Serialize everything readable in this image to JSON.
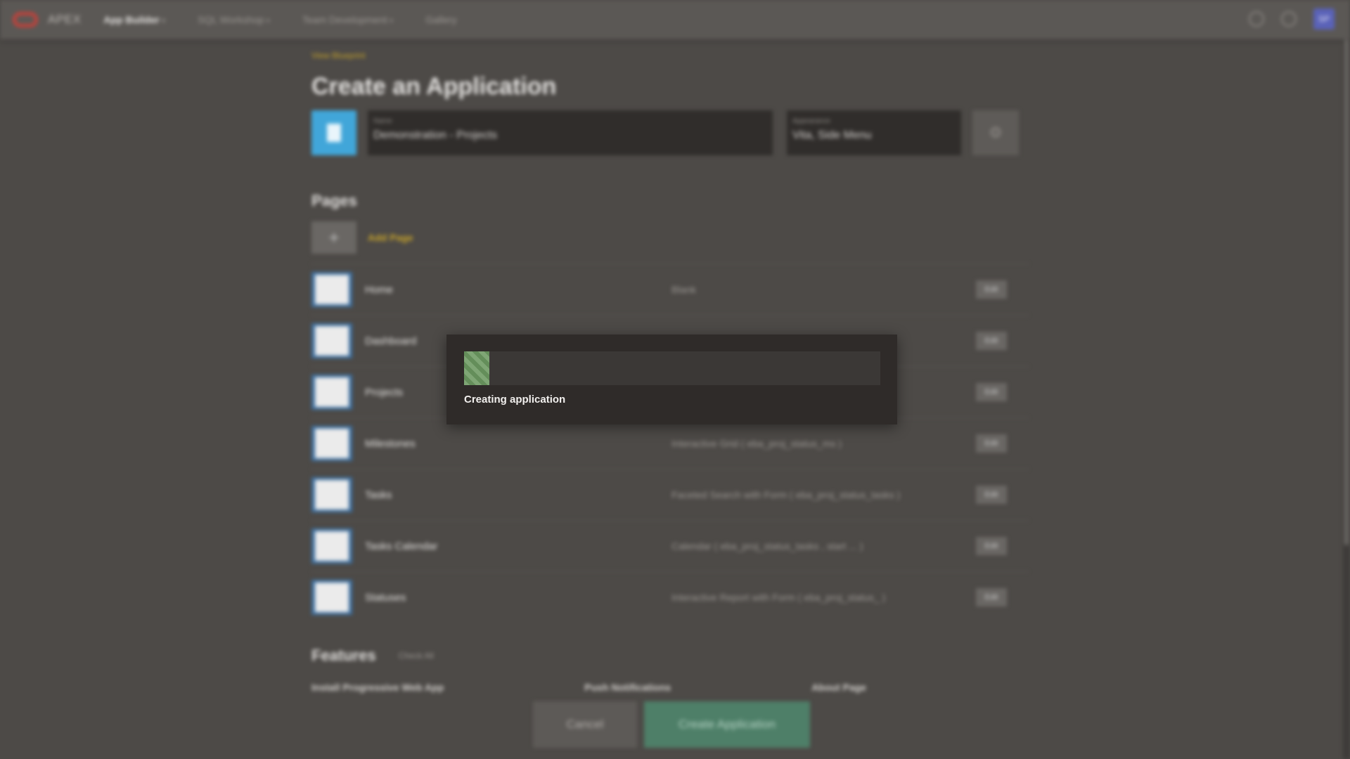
{
  "topbar": {
    "brand": "APEX",
    "nav": [
      {
        "label": "App Builder",
        "active": true,
        "caret": true
      },
      {
        "label": "SQL Workshop",
        "active": false,
        "caret": true
      },
      {
        "label": "Team Development",
        "active": false,
        "caret": true
      },
      {
        "label": "Gallery",
        "active": false,
        "caret": false
      }
    ],
    "user_initials": "SP"
  },
  "content": {
    "breadcrumb": "View Blueprint",
    "title": "Create an Application",
    "name_label": "Name",
    "name_value": "Demonstration - Projects",
    "appearance_label": "Appearance",
    "appearance_value": "Vita, Side Menu",
    "pages_title": "Pages",
    "add_page_label": "Add Page",
    "pages": [
      {
        "name": "Home",
        "type": "Blank",
        "edit": "Edit"
      },
      {
        "name": "Dashboard",
        "type": "",
        "edit": "Edit"
      },
      {
        "name": "Projects",
        "type": "",
        "edit": "Edit"
      },
      {
        "name": "Milestones",
        "type": "Interactive Grid ( eba_proj_status_ms )",
        "edit": "Edit"
      },
      {
        "name": "Tasks",
        "type": "Faceted Search with Form ( eba_proj_status_tasks )",
        "edit": "Edit"
      },
      {
        "name": "Tasks Calendar",
        "type": "Calendar ( eba_proj_status_tasks , start ... )",
        "edit": "Edit"
      },
      {
        "name": "Statuses",
        "type": "Interactive Report with Form ( eba_proj_status_ )",
        "edit": "Edit"
      }
    ],
    "features_title": "Features",
    "check_all_label": "Check All",
    "features": [
      "Install Progressive Web App",
      "Push Notifications",
      "About Page"
    ]
  },
  "footer": {
    "cancel_label": "Cancel",
    "create_label": "Create Application"
  },
  "dialog": {
    "message": "Creating application",
    "progress_percent": 6
  }
}
